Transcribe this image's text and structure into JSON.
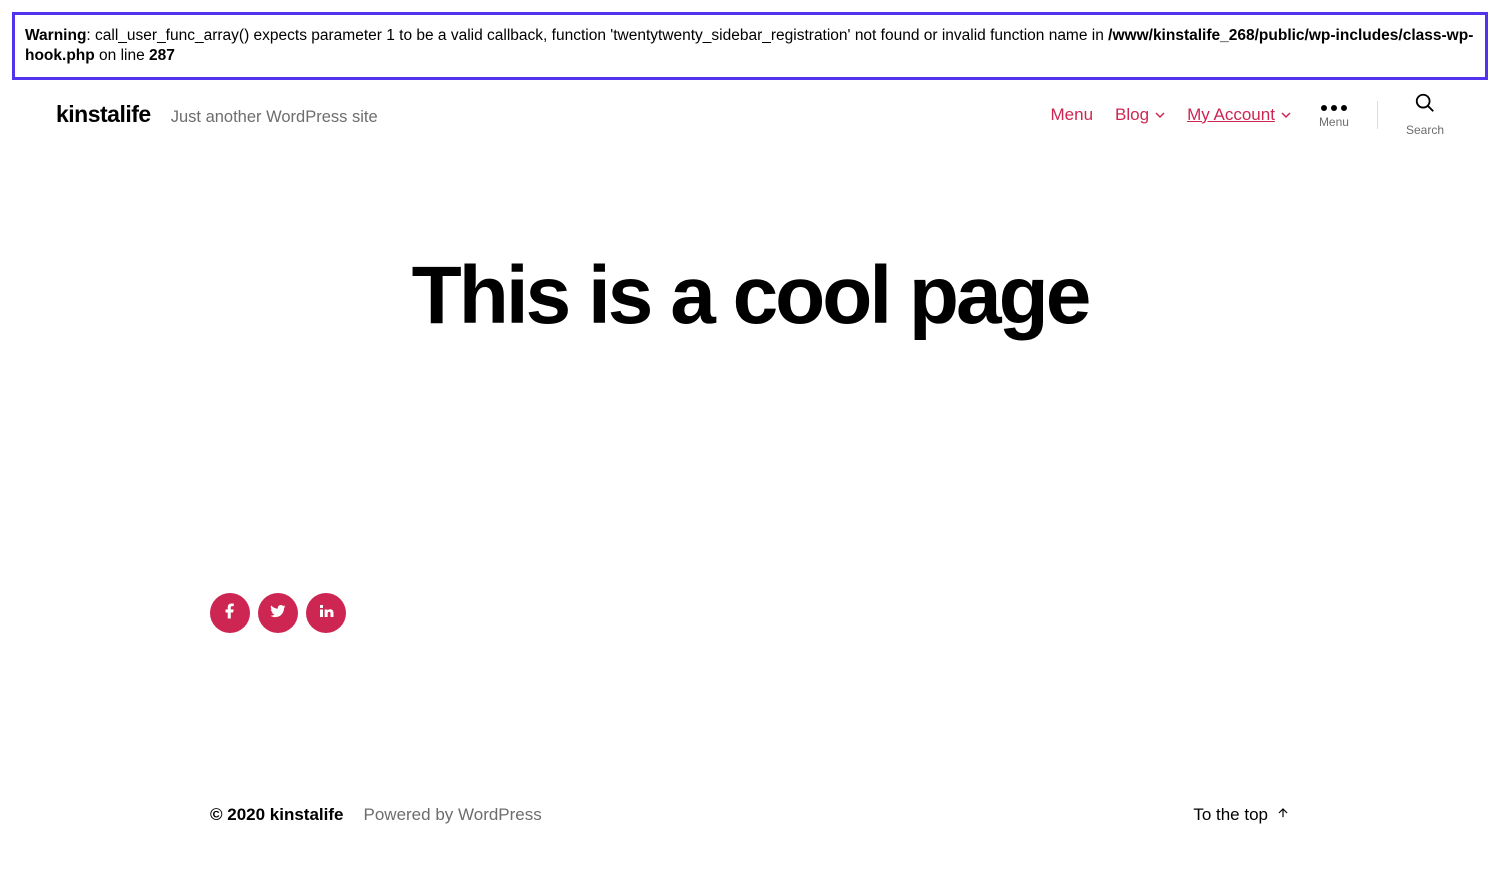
{
  "warning": {
    "label": "Warning",
    "message": ": call_user_func_array() expects parameter 1 to be a valid callback, function 'twentytwenty_sidebar_registration' not found or invalid function name in ",
    "file": "/www/kinstalife_268/public/wp-includes/class-wp-hook.php",
    "on_line_text": " on line ",
    "line": "287"
  },
  "header": {
    "site_title": "kinstalife",
    "tagline": "Just another WordPress site",
    "nav": {
      "menu": "Menu",
      "blog": "Blog",
      "account": "My Account"
    },
    "menu_toggle_label": "Menu",
    "search_toggle_label": "Search"
  },
  "page": {
    "title": "This is a cool page"
  },
  "social": {
    "facebook": "facebook",
    "twitter": "twitter",
    "linkedin": "linkedin"
  },
  "footer": {
    "copyright": "© 2020 kinstalife",
    "powered": "Powered by WordPress",
    "to_top": "To the top"
  }
}
